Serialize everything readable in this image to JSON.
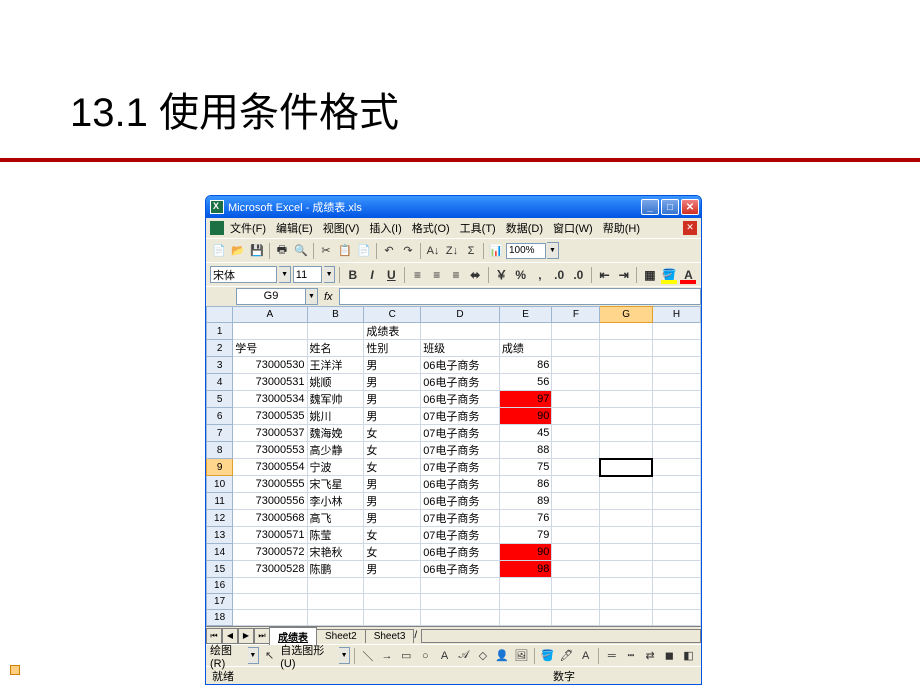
{
  "slide": {
    "title": "13.1  使用条件格式"
  },
  "window": {
    "title": "Microsoft Excel - 成绩表.xls",
    "menus": [
      "文件(F)",
      "编辑(E)",
      "视图(V)",
      "插入(I)",
      "格式(O)",
      "工具(T)",
      "数据(D)",
      "窗口(W)",
      "帮助(H)"
    ],
    "zoom": "100%",
    "font": "宋体",
    "fontsize": "11",
    "namebox": "G9",
    "status_left": "就绪",
    "status_right": "数字",
    "draw_label": "绘图(R)",
    "autoshape_label": "自选图形(U)"
  },
  "sheet": {
    "columns": [
      "A",
      "B",
      "C",
      "D",
      "E",
      "F",
      "G",
      "H"
    ],
    "title_cell": "成绩表",
    "headers": {
      "a": "学号",
      "b": "姓名",
      "c": "性别",
      "d": "班级",
      "e": "成绩"
    },
    "rows": [
      {
        "id": "73000530",
        "name": "王洋洋",
        "sex": "男",
        "class": "06电子商务",
        "score": "86",
        "hl": false
      },
      {
        "id": "73000531",
        "name": "姚顺",
        "sex": "男",
        "class": "06电子商务",
        "score": "56",
        "hl": false
      },
      {
        "id": "73000534",
        "name": "魏军帅",
        "sex": "男",
        "class": "06电子商务",
        "score": "97",
        "hl": true
      },
      {
        "id": "73000535",
        "name": "姚川",
        "sex": "男",
        "class": "07电子商务",
        "score": "90",
        "hl": true
      },
      {
        "id": "73000537",
        "name": "魏海娩",
        "sex": "女",
        "class": "07电子商务",
        "score": "45",
        "hl": false
      },
      {
        "id": "73000553",
        "name": "高少静",
        "sex": "女",
        "class": "07电子商务",
        "score": "88",
        "hl": false
      },
      {
        "id": "73000554",
        "name": "宁波",
        "sex": "女",
        "class": "07电子商务",
        "score": "75",
        "hl": false
      },
      {
        "id": "73000555",
        "name": "宋飞星",
        "sex": "男",
        "class": "06电子商务",
        "score": "86",
        "hl": false
      },
      {
        "id": "73000556",
        "name": "李小林",
        "sex": "男",
        "class": "06电子商务",
        "score": "89",
        "hl": false
      },
      {
        "id": "73000568",
        "name": "高飞",
        "sex": "男",
        "class": "07电子商务",
        "score": "76",
        "hl": false
      },
      {
        "id": "73000571",
        "name": "陈莹",
        "sex": "女",
        "class": "07电子商务",
        "score": "79",
        "hl": false
      },
      {
        "id": "73000572",
        "name": "宋艳秋",
        "sex": "女",
        "class": "06电子商务",
        "score": "90",
        "hl": true
      },
      {
        "id": "73000528",
        "name": "陈鹏",
        "sex": "男",
        "class": "06电子商务",
        "score": "98",
        "hl": true
      }
    ],
    "tabs": [
      "成绩表",
      "Sheet2",
      "Sheet3"
    ],
    "selected_cell": "G9"
  }
}
